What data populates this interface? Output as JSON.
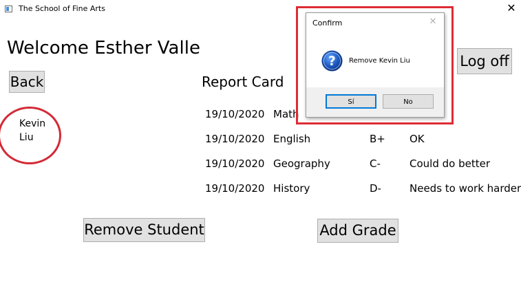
{
  "window": {
    "title": "The School of Fine Arts",
    "close_glyph": "✕"
  },
  "header": {
    "welcome": "Welcome Esther Valle"
  },
  "buttons": {
    "back": "Back",
    "log_off": "Log off",
    "remove_student": "Remove Student",
    "add_grade": "Add Grade"
  },
  "student": {
    "name": "Kevin Liu"
  },
  "report_card": {
    "title": "Report Card",
    "rows": [
      {
        "date": "19/10/2020",
        "subject": "Math",
        "grade": "",
        "comment": ""
      },
      {
        "date": "19/10/2020",
        "subject": "English",
        "grade": "B+",
        "comment": "OK"
      },
      {
        "date": "19/10/2020",
        "subject": "Geography",
        "grade": "C-",
        "comment": "Could do better"
      },
      {
        "date": "19/10/2020",
        "subject": "History",
        "grade": "D-",
        "comment": "Needs to work harder"
      }
    ]
  },
  "dialog": {
    "title": "Confirm",
    "close_glyph": "✕",
    "message": "Remove Kevin Liu",
    "yes_label": "Sí",
    "no_label": "No",
    "icon": "question-icon"
  },
  "colors": {
    "highlight": "#dd2b35",
    "button_face": "#e1e1e1",
    "button_border": "#adadad",
    "focus_border": "#0078d7",
    "icon_blue": "#1d5cc4"
  }
}
